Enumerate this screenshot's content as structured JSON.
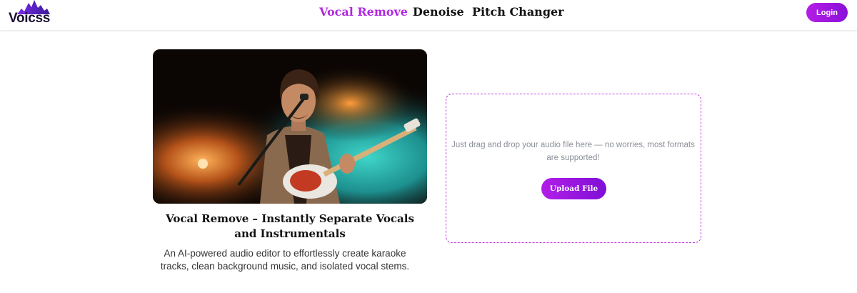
{
  "brand": {
    "name": "Voicss"
  },
  "nav": {
    "items": [
      {
        "label": "Vocal Remove",
        "active": true
      },
      {
        "label": "Denoise",
        "active": false
      },
      {
        "label": "Pitch Changer",
        "active": false
      }
    ]
  },
  "header": {
    "login_label": "Login"
  },
  "hero": {
    "image": {
      "subject": "guitarist singing into microphone on stage"
    },
    "title": "Vocal Remove – Instantly Separate Vocals and Instrumentals",
    "description": "An AI-powered audio editor to effortlessly create karaoke tracks, clean background music, and isolated vocal stems."
  },
  "upload": {
    "hint": "Just drag and drop your audio file here — no worries, most formats are supported!",
    "button_label": "Upload File"
  },
  "colors": {
    "accent": "#b028e0",
    "button_gradient_start": "#b41ee6",
    "button_gradient_end": "#8a10d8",
    "dashed_border": "#c13ee0"
  }
}
